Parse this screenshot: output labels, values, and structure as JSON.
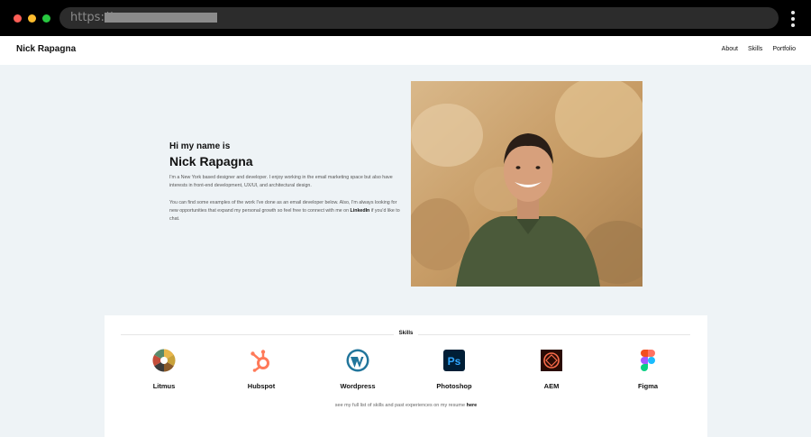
{
  "browser": {
    "url_scheme": "https://"
  },
  "header": {
    "brand": "Nick Rapagna",
    "nav": [
      "About",
      "Skills",
      "Portfolio"
    ]
  },
  "hero": {
    "greeting": "Hi my name is",
    "name": "Nick Rapagna",
    "paragraph1": "I'm a New York based designer and developer. I enjoy working in the email marketing space but also have interests in front-end development, UX/UI, and architectural design.",
    "paragraph2_before": "You can find some examples of the work I've done as an email developer below. Also, I'm always looking for new opportunities that expand my personal growth so feel free to connect with me on ",
    "paragraph2_link": "LinkedIn",
    "paragraph2_after": " if you'd like to chat."
  },
  "skills": {
    "title": "Skills",
    "items": [
      {
        "label": "Litmus",
        "icon": "litmus-icon"
      },
      {
        "label": "Hubspot",
        "icon": "hubspot-icon"
      },
      {
        "label": "Wordpress",
        "icon": "wordpress-icon"
      },
      {
        "label": "Photoshop",
        "icon": "photoshop-icon"
      },
      {
        "label": "AEM",
        "icon": "aem-icon"
      },
      {
        "label": "Figma",
        "icon": "figma-icon"
      }
    ],
    "resume_text": "see my full list of skills and past experiences on my resume ",
    "resume_link": "here"
  },
  "colors": {
    "page_bg": "#eef3f6",
    "hubspot": "#ff7a59",
    "wordpress": "#21759b",
    "photoshop_bg": "#001e36",
    "photoshop_fg": "#31a8ff",
    "aem": "#fa0f00"
  }
}
